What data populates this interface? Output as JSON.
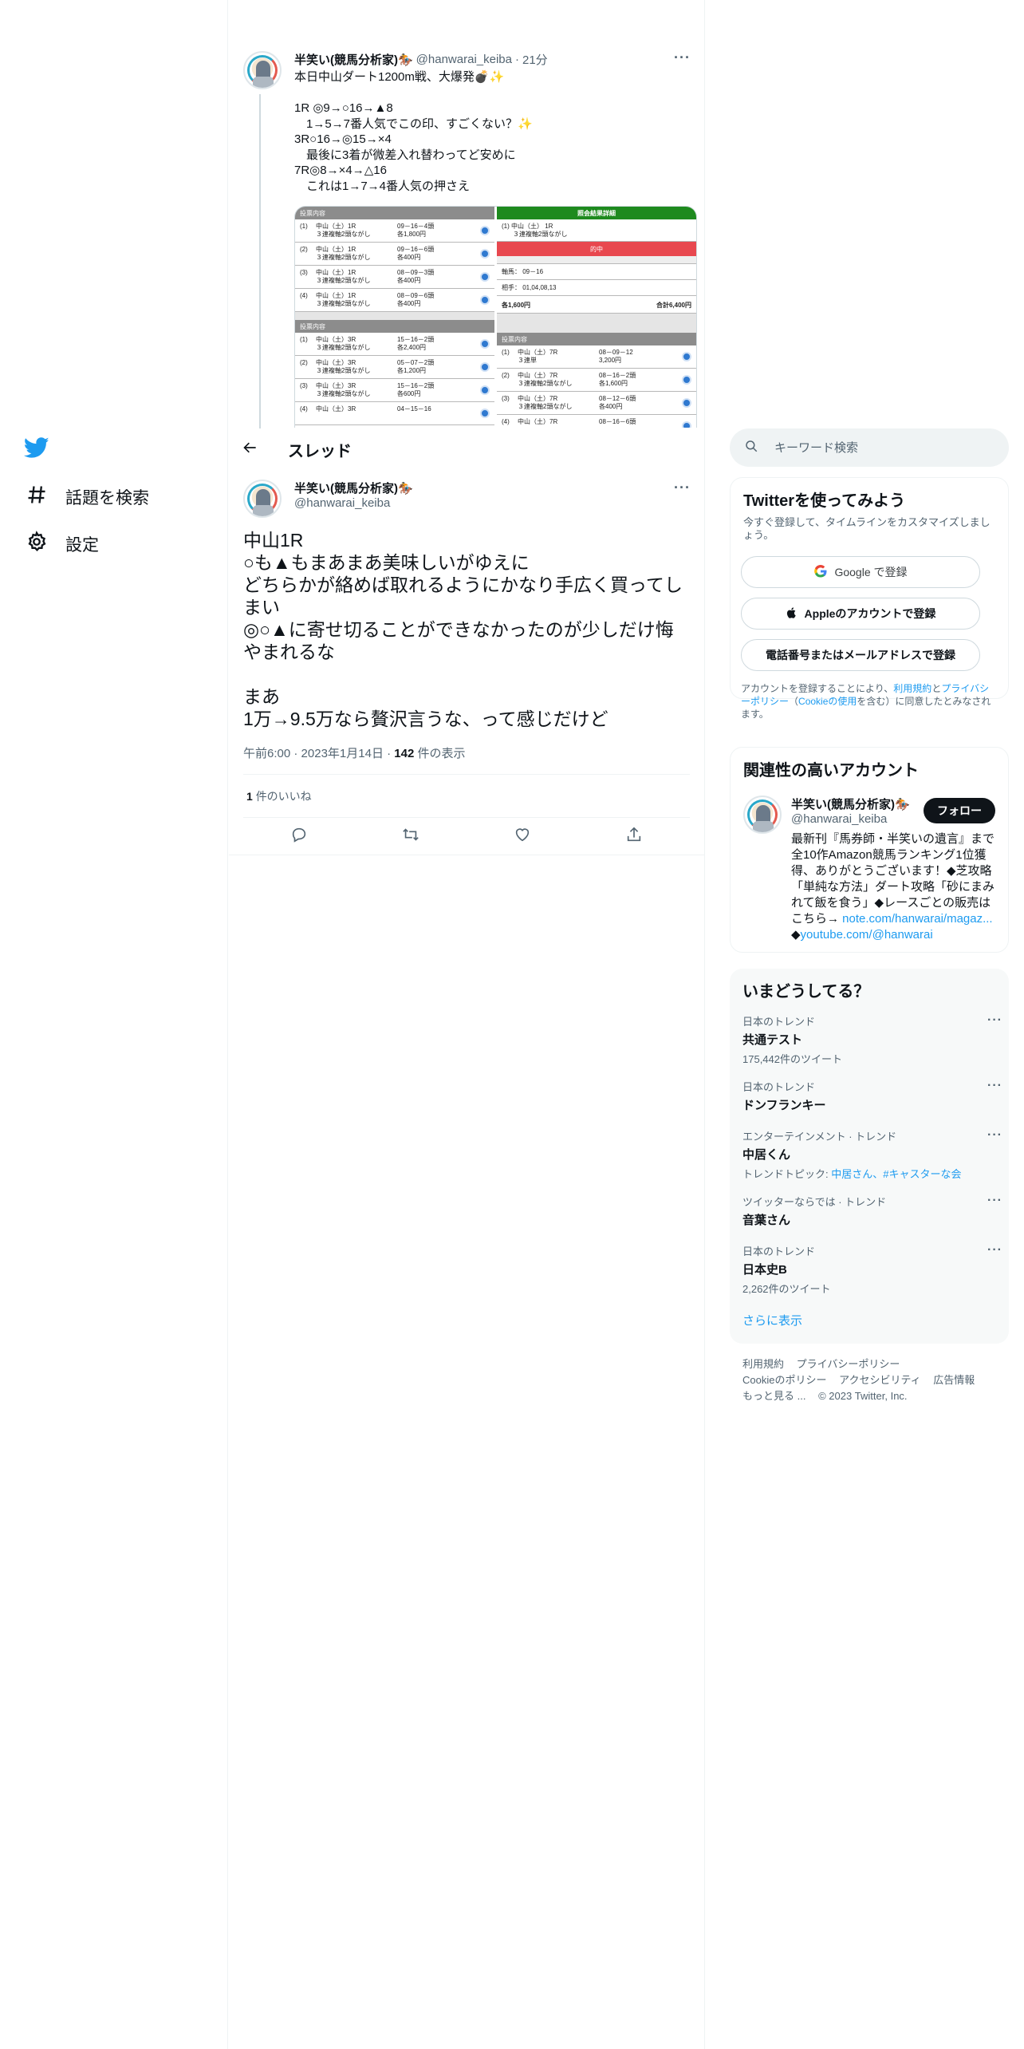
{
  "nav": {
    "explore_label": "話題を検索",
    "settings_label": "設定"
  },
  "parent_tweet": {
    "name": "半笑い(競馬分析家)🏇",
    "handle": "@hanwarai_keiba",
    "separator": "·",
    "time": "21分",
    "text": "本日中山ダート1200m戦、大爆発💣✨\n\n1R ◎9→○16→▲8\n　1→5→7番人気でこの印、すごくない？✨\n3R○16→◎15→×4\n　最後に3着が微差入れ替わってど安めに\n7R◎8→×4→△16\n　これは1→7→4番人気の押さえ",
    "more": "···",
    "slip": {
      "left_header": "投票内容",
      "left_rows": [
        {
          "no": "(1)",
          "race": "中山（土）1R",
          "type": "３連複軸2頭ながし",
          "horses": "09－16－4頭",
          "amount": "各1,800円"
        },
        {
          "no": "(2)",
          "race": "中山（土）1R",
          "type": "３連複軸2頭ながし",
          "horses": "09－16－6頭",
          "amount": "各400円"
        },
        {
          "no": "(3)",
          "race": "中山（土）1R",
          "type": "３連複軸2頭ながし",
          "horses": "08－09－3頭",
          "amount": "各400円"
        },
        {
          "no": "(4)",
          "race": "中山（土）1R",
          "type": "３連複軸2頭ながし",
          "horses": "08－09－6頭",
          "amount": "各400円"
        }
      ],
      "left_header2": "投票内容",
      "left_rows2": [
        {
          "no": "(1)",
          "race": "中山（土）3R",
          "type": "３連複軸2頭ながし",
          "horses": "15－16－2頭",
          "amount": "各2,400円"
        },
        {
          "no": "(2)",
          "race": "中山（土）3R",
          "type": "３連複軸2頭ながし",
          "horses": "05－07－2頭",
          "amount": "各1,200円"
        },
        {
          "no": "(3)",
          "race": "中山（土）3R",
          "type": "３連複軸2頭ながし",
          "horses": "15－16－2頭",
          "amount": "各600円"
        },
        {
          "no": "(4)",
          "race": "中山（土）3R",
          "type": "",
          "horses": "04－15－16",
          "amount": ""
        }
      ],
      "right_header": "照会結果詳細",
      "right_race": "(1) 中山（土） 1R",
      "right_type": "３連複軸2頭ながし",
      "right_hit": "的中",
      "right_axis": "軸馬： 09－16",
      "right_partner": "相手： 01,04,08,13",
      "right_each": "各1,600円",
      "right_total": "合計6,400円",
      "right_header2": "投票内容",
      "right_rows2": [
        {
          "no": "(1)",
          "race": "中山（土）7R",
          "type": "３連単",
          "horses": "08－09－12",
          "amount": "3,200円"
        },
        {
          "no": "(2)",
          "race": "中山（土）7R",
          "type": "３連複軸2頭ながし",
          "horses": "08－16－2頭",
          "amount": "各1,600円"
        },
        {
          "no": "(3)",
          "race": "中山（土）7R",
          "type": "３連複軸2頭ながし",
          "horses": "08－12－6頭",
          "amount": "各400円"
        },
        {
          "no": "(4)",
          "race": "中山（土）7R",
          "type": "",
          "horses": "08－16－6頭",
          "amount": ""
        }
      ]
    }
  },
  "thread_header": {
    "title": "スレッド"
  },
  "focused_tweet": {
    "name": "半笑い(競馬分析家)🏇",
    "handle": "@hanwarai_keiba",
    "more": "···",
    "text": "中山1R\n○も▲もまあまあ美味しいがゆえに\nどちらかが絡めば取れるようにかなり手広く買ってしまい\n◎○▲に寄せ切ることができなかったのが少しだけ悔やまれるな\n\nまあ\n1万→9.5万なら贅沢言うな、って感じだけど",
    "time": "午前6:00",
    "sep1": "·",
    "date": "2023年1月14日",
    "sep2": "·",
    "views": "142",
    "views_label": "件の表示",
    "likes": "1",
    "likes_label": "件のいいね"
  },
  "search": {
    "placeholder": "キーワード検索"
  },
  "signup": {
    "title": "Twitterを使ってみよう",
    "subtitle": "今すぐ登録して、タイムラインをカスタマイズしましょう。",
    "google_label": "Google で登録",
    "apple_label": "Appleのアカウントで登録",
    "phone_label": "電話番号またはメールアドレスで登録",
    "legal_pre": "アカウントを登録することにより、",
    "legal_terms": "利用規約",
    "legal_and": "と",
    "legal_privacy": "プライバシーポリシー",
    "legal_open": "（",
    "legal_cookie": "Cookieの使用",
    "legal_post": "を含む）に同意したとみなされます。"
  },
  "related": {
    "title": "関連性の高いアカウント",
    "name": "半笑い(競馬分析家)🏇",
    "handle": "@hanwarai_keiba",
    "follow_label": "フォロー",
    "bio": "最新刊『馬券師・半笑いの遺言』まで全10作Amazon競馬ランキング1位獲得、ありがとうございます！◆芝攻略「単純な方法」ダート攻略「砂にまみれて飯を食う」◆レースごとの販売はこちら→ ",
    "bio_link1": "note.com/hanwarai/magaz...",
    "bio_bullet": "◆",
    "bio_link2": "youtube.com/@hanwarai"
  },
  "trends": {
    "title": "いまどうしてる？",
    "items": [
      {
        "context": "日本のトレンド",
        "name": "共通テスト",
        "count": "175,442件のツイート"
      },
      {
        "context": "日本のトレンド",
        "name": "ドンフランキー",
        "count": ""
      },
      {
        "context": "エンターテインメント · トレンド",
        "name": "中居くん",
        "topic_label": "トレンドトピック: ",
        "topic_links": "中居さん、#キャスターな会"
      },
      {
        "context": "ツイッターならでは · トレンド",
        "name": "音葉さん",
        "count": ""
      },
      {
        "context": "日本のトレンド",
        "name": "日本史B",
        "count": "2,262件のツイート"
      }
    ],
    "more_icon": "···",
    "show_more": "さらに表示"
  },
  "footer": {
    "terms": "利用規約",
    "privacy": "プライバシーポリシー",
    "cookie": "Cookieのポリシー",
    "accessibility": "アクセシビリティ",
    "ads": "広告情報",
    "more": "もっと見る ...",
    "copyright": "© 2023 Twitter, Inc."
  },
  "colors": {
    "accent": "#1d9bf0",
    "text_primary": "#0f1419",
    "text_secondary": "#536471",
    "follow_bg": "#0f1419",
    "slip_green": "#1e8a1e",
    "slip_hit_red": "#e8484f"
  },
  "icons": {
    "logo": "twitter-bird-icon",
    "explore": "hashtag-icon",
    "settings": "gear-icon",
    "back": "arrow-left-icon",
    "search": "search-icon",
    "reply": "reply-icon",
    "retweet": "retweet-icon",
    "like": "heart-icon",
    "share": "share-icon"
  }
}
